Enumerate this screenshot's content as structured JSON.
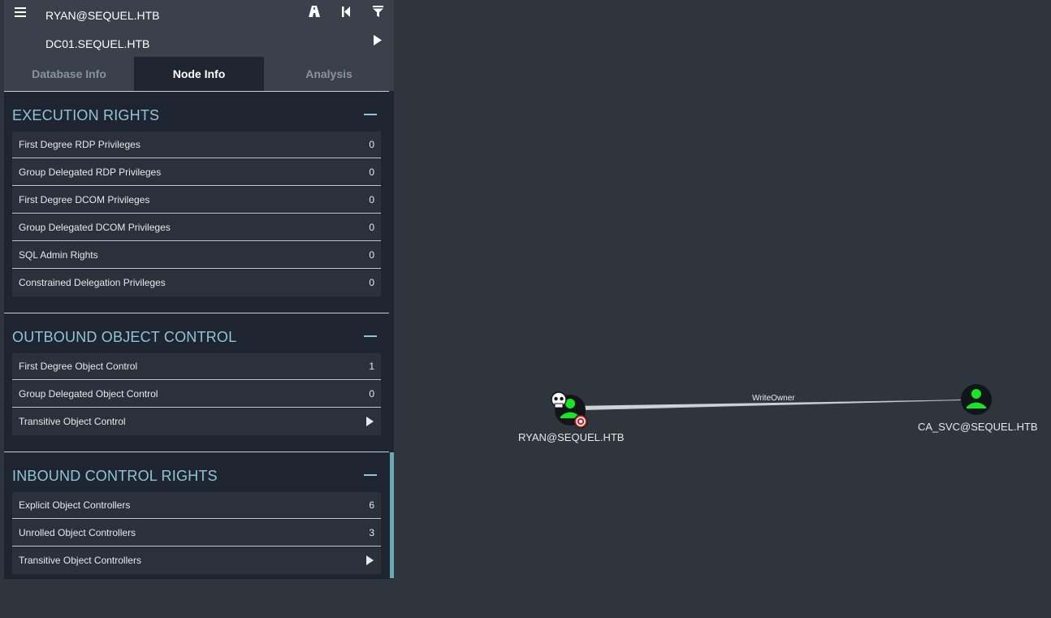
{
  "search": {
    "start_node": "RYAN@SEQUEL.HTB",
    "target_node": "DC01.SEQUEL.HTB"
  },
  "icons": {
    "menu": "menu-icon",
    "pathfinding": "road-icon",
    "back": "skip-back-icon",
    "filter": "filter-icon",
    "play": "play-icon"
  },
  "tabs": [
    {
      "label": "Database Info"
    },
    {
      "label": "Node Info"
    },
    {
      "label": "Analysis"
    }
  ],
  "sections": {
    "execution": {
      "title": "EXECUTION RIGHTS",
      "rows": [
        {
          "label": "First Degree RDP Privileges",
          "value": "0"
        },
        {
          "label": "Group Delegated RDP Privileges",
          "value": "0"
        },
        {
          "label": "First Degree DCOM Privileges",
          "value": "0"
        },
        {
          "label": "Group Delegated DCOM Privileges",
          "value": "0"
        },
        {
          "label": "SQL Admin Rights",
          "value": "0"
        },
        {
          "label": "Constrained Delegation Privileges",
          "value": "0"
        }
      ]
    },
    "outbound": {
      "title": "OUTBOUND OBJECT CONTROL",
      "rows": [
        {
          "label": "First Degree Object Control",
          "value": "1"
        },
        {
          "label": "Group Delegated Object Control",
          "value": "0"
        },
        {
          "label": "Transitive Object Control"
        }
      ]
    },
    "inbound": {
      "title": "INBOUND CONTROL RIGHTS",
      "rows": [
        {
          "label": "Explicit Object Controllers",
          "value": "6"
        },
        {
          "label": "Unrolled Object Controllers",
          "value": "3"
        },
        {
          "label": "Transitive Object Controllers"
        }
      ]
    }
  },
  "graph": {
    "nodes": [
      {
        "label": "RYAN@SEQUEL.HTB",
        "owned": true,
        "high_value": true
      },
      {
        "label": "CA_SVC@SEQUEL.HTB"
      }
    ],
    "edge_label": "WriteOwner"
  },
  "colors": {
    "background": "#2f353c",
    "panel": "#1f2530",
    "accent": "#8ec5d8",
    "user_node": "#17e625"
  }
}
